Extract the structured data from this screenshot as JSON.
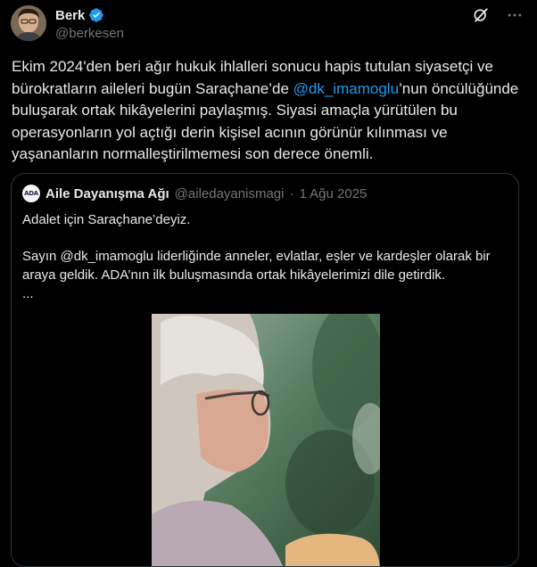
{
  "author": {
    "name": "Berk",
    "handle": "@berkesen",
    "verified": true
  },
  "icons": {
    "grok": "grok-icon",
    "more": "more-icon",
    "verified": "verified-badge-icon"
  },
  "tweet": {
    "text_part1": "Ekim 2024'den beri ağır hukuk ihlalleri sonucu hapis tutulan siyasetçi ve bürokratların aileleri bugün Saraçhane’de ",
    "mention": "@dk_imamoglu",
    "text_part2": "’nun öncülüğünde buluşarak ortak hikâyelerini paylaşmış. Siyasi amaçla yürütülen bu operasyonların yol açtığı derin kişisel acının görünür kılınması ve yaşananların normalleştirilmemesi son derece önemli."
  },
  "quoted": {
    "avatar_text": "ADA",
    "name": "Aile Dayanışma Ağı",
    "handle": "@ailedayanismagi",
    "separator": "·",
    "date": "1 Ağu 2025",
    "line1": "Adalet için Saraçhane’deyiz.",
    "line2": "Sayın @dk_imamoglu liderliğinde anneler, evlatlar, eşler ve kardeşler olarak bir araya geldik. ADA’nın ilk buluşmasında ortak hikâyelerimizi dile getirdik.",
    "line3": "..."
  },
  "colors": {
    "background": "#000000",
    "text": "#e7e9ea",
    "secondary": "#71767b",
    "link": "#1d9bf0",
    "border": "#2f3336"
  }
}
